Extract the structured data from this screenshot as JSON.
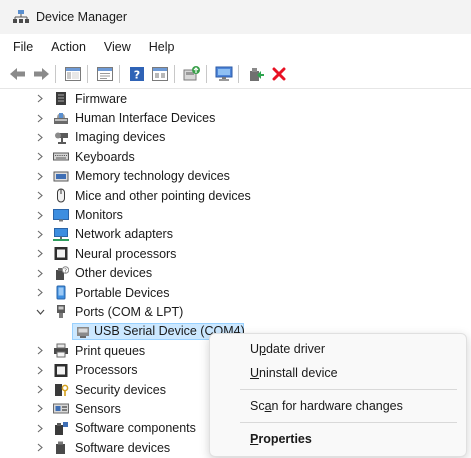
{
  "window": {
    "title": "Device Manager",
    "icon": "device-manager-icon"
  },
  "menubar": {
    "items": [
      {
        "label": "File"
      },
      {
        "label": "Action"
      },
      {
        "label": "View"
      },
      {
        "label": "Help"
      }
    ]
  },
  "toolbar": {
    "buttons": [
      {
        "icon": "back-arrow-icon"
      },
      {
        "icon": "forward-arrow-icon"
      },
      {
        "icon": "show-hide-console-tree-icon"
      },
      {
        "icon": "properties-icon"
      },
      {
        "icon": "help-icon"
      },
      {
        "icon": "view-icon"
      },
      {
        "icon": "update-driver-icon"
      },
      {
        "icon": "scan-hardware-icon"
      },
      {
        "icon": "enable-device-icon"
      },
      {
        "icon": "uninstall-device-icon"
      }
    ]
  },
  "tree": {
    "items": [
      {
        "label": "Firmware",
        "icon": "firmware-icon",
        "expanded": false
      },
      {
        "label": "Human Interface Devices",
        "icon": "hid-icon",
        "expanded": false
      },
      {
        "label": "Imaging devices",
        "icon": "camera-icon",
        "expanded": false
      },
      {
        "label": "Keyboards",
        "icon": "keyboard-icon",
        "expanded": false
      },
      {
        "label": "Memory technology devices",
        "icon": "memory-icon",
        "expanded": false
      },
      {
        "label": "Mice and other pointing devices",
        "icon": "mouse-icon",
        "expanded": false
      },
      {
        "label": "Monitors",
        "icon": "monitor-icon",
        "expanded": false
      },
      {
        "label": "Network adapters",
        "icon": "network-icon",
        "expanded": false
      },
      {
        "label": "Neural processors",
        "icon": "processor-icon",
        "expanded": false
      },
      {
        "label": "Other devices",
        "icon": "unknown-device-icon",
        "expanded": false
      },
      {
        "label": "Portable Devices",
        "icon": "portable-device-icon",
        "expanded": false
      },
      {
        "label": "Ports (COM & LPT)",
        "icon": "port-icon",
        "expanded": true
      },
      {
        "label": "USB Serial Device (COM4)",
        "icon": "port-icon",
        "child": true,
        "selected": true
      },
      {
        "label": "Print queues",
        "icon": "printer-icon",
        "expanded": false
      },
      {
        "label": "Processors",
        "icon": "processor-icon",
        "expanded": false
      },
      {
        "label": "Security devices",
        "icon": "security-icon",
        "expanded": false
      },
      {
        "label": "Sensors",
        "icon": "sensor-icon",
        "expanded": false
      },
      {
        "label": "Software components",
        "icon": "software-component-icon",
        "expanded": false
      },
      {
        "label": "Software devices",
        "icon": "software-device-icon",
        "expanded": false
      }
    ]
  },
  "context_menu": {
    "update_driver": {
      "pre": "U",
      "accel": "p",
      "post": "date driver"
    },
    "uninstall_device": {
      "pre": "",
      "accel": "U",
      "post": "ninstall device"
    },
    "scan_hardware": {
      "pre": "Sc",
      "accel": "a",
      "post": "n for hardware changes"
    },
    "properties": {
      "pre": "",
      "accel": "P",
      "post": "roperties"
    }
  },
  "colors": {
    "selection_bg": "#cce8ff",
    "selection_border": "#99d1ff",
    "uninstall_red": "#e81123",
    "titlebar_bg": "#f3f3f3"
  }
}
